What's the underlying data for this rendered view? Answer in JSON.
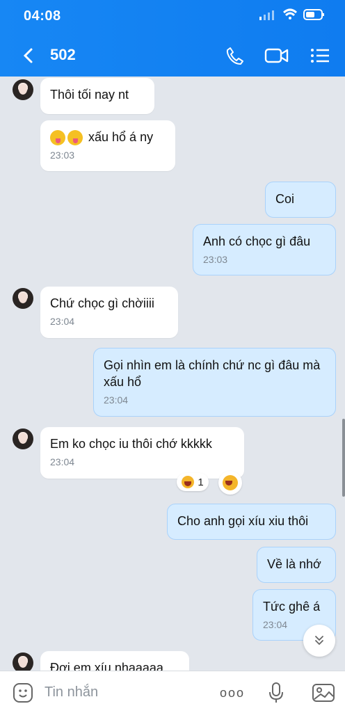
{
  "status": {
    "time": "04:08"
  },
  "header": {
    "title": "502"
  },
  "messages": [
    {
      "side": "left",
      "text": "Thôi tối nay nt",
      "time": ""
    },
    {
      "side": "left",
      "text": "xấu hổ á ny",
      "time": "23:03"
    },
    {
      "side": "right",
      "text": "Coi",
      "time": ""
    },
    {
      "side": "right",
      "text": "Anh có chọc gì đâu",
      "time": "23:03"
    },
    {
      "side": "left",
      "text": "Chứ chọc gì chờiiii",
      "time": "23:04"
    },
    {
      "side": "right",
      "text": "Gọi nhìn em là chính chứ nc gì đâu mà xấu hổ",
      "time": "23:04"
    },
    {
      "side": "left",
      "text": "Em ko chọc iu thôi chớ kkkkk",
      "time": "23:04"
    },
    {
      "side": "right",
      "text": "Cho anh gọi xíu xiu thôi",
      "time": ""
    },
    {
      "side": "right",
      "text": "Về là nhớ",
      "time": ""
    },
    {
      "side": "right",
      "text": "Tức ghê á",
      "time": "23:04"
    },
    {
      "side": "left",
      "text": "Đợi em xíu nhaaaaa",
      "time": ""
    }
  ],
  "reaction": {
    "count": "1"
  },
  "composer": {
    "placeholder": "Tin nhắn",
    "more": "ooo"
  },
  "colors": {
    "header": "#0f7cf0",
    "sent_bubble": "#d6ecff",
    "chat_background": "#e2e6ec"
  },
  "icons": [
    "back-icon",
    "phone-icon",
    "video-icon",
    "list-icon",
    "sticker-icon",
    "mic-icon",
    "image-icon",
    "chevron-down-icon"
  ]
}
